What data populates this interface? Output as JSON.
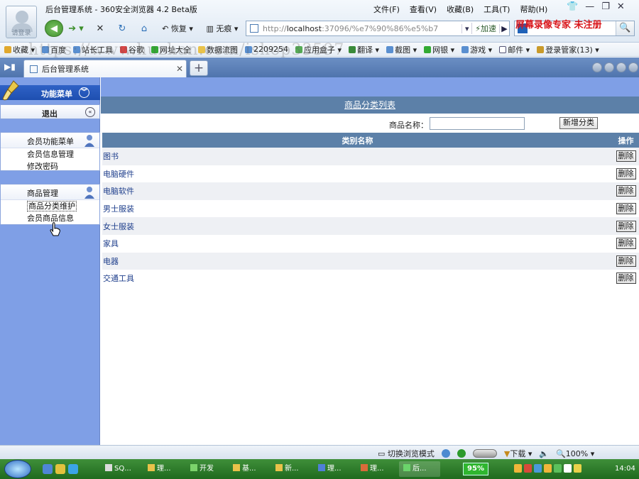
{
  "browser": {
    "avatar_label": "请登录",
    "window_title": "后台管理系统 - 360安全浏览器 4.2 Beta版",
    "menus": [
      "文件(F)",
      "查看(V)",
      "收藏(B)",
      "工具(T)",
      "帮助(H)"
    ],
    "window_controls": [
      "👕",
      "—",
      "❐",
      "✕"
    ],
    "nav": {
      "back": "◀",
      "forward": "➔ ▾",
      "stop": "✕",
      "refresh": "↻",
      "home": "⌂",
      "restore_label": "↶ 恢复 ▾",
      "trace_label": "▥ 无痕 ▾"
    },
    "address": {
      "scheme": "http://",
      "host": "localhost",
      "rest": ":37096/%e7%90%86%e5%b7",
      "dropdown": "▾",
      "speed_label": "⚡加速",
      "go": "▶"
    },
    "search": {
      "go": "🔍"
    },
    "watermark_red": "屏幕录像专家  未注册",
    "bookmarks": [
      "收藏 ▾",
      "百度",
      "站长工具",
      "谷歌",
      "网址大全",
      "数据流图",
      "2209254",
      "应用盒子 ▾",
      "翻译 ▾",
      "截图 ▾",
      "网银 ▾",
      "游戏 ▾",
      "邮件 ▾",
      "登录管家(13) ▾"
    ],
    "watermark_url": "https://www.huzhan.com/ishop33597",
    "tab": {
      "sidebar_toggle": "▶▮",
      "title": "后台管理系统",
      "close": "✕",
      "new": "+"
    }
  },
  "sidebar": {
    "header_label": "功能菜单",
    "header_chevron": "︾",
    "logout_label": "退出",
    "logout_chevron": "«",
    "member_menu": {
      "title": "会员功能菜单",
      "items": [
        "会员信息管理",
        "修改密码"
      ]
    },
    "goods_menu": {
      "title": "商品管理",
      "items": [
        "商品分类维护",
        "会员商品信息"
      ]
    }
  },
  "main": {
    "list_title": "商品分类列表",
    "search_label": "商品名称：",
    "search_value": "",
    "add_button": "新增分类",
    "table": {
      "headers": [
        "类别名称",
        "操作"
      ],
      "rows": [
        {
          "name": "图书",
          "action": "删除"
        },
        {
          "name": "电脑硬件",
          "action": "删除"
        },
        {
          "name": "电脑软件",
          "action": "删除"
        },
        {
          "name": "男士服装",
          "action": "删除"
        },
        {
          "name": "女士服装",
          "action": "删除"
        },
        {
          "name": "家具",
          "action": "删除"
        },
        {
          "name": "电器",
          "action": "删除"
        },
        {
          "name": "交通工具",
          "action": "删除"
        }
      ]
    }
  },
  "statusbar": {
    "switch_mode": "切换浏览模式",
    "download": "下载 ▾",
    "zoom": "100% ▾"
  },
  "taskbar": {
    "tasks": [
      "SQ...",
      "理...",
      "开发",
      "基...",
      "新...",
      "理...",
      "理...",
      "后..."
    ],
    "cpu": "95%",
    "clock": "14:04"
  },
  "colors": {
    "sidebar_bg": "#7f9fe6",
    "table_header_bg": "#5c80a8",
    "link_text": "#1f3f8c",
    "taskbar": "#2b7b29"
  }
}
